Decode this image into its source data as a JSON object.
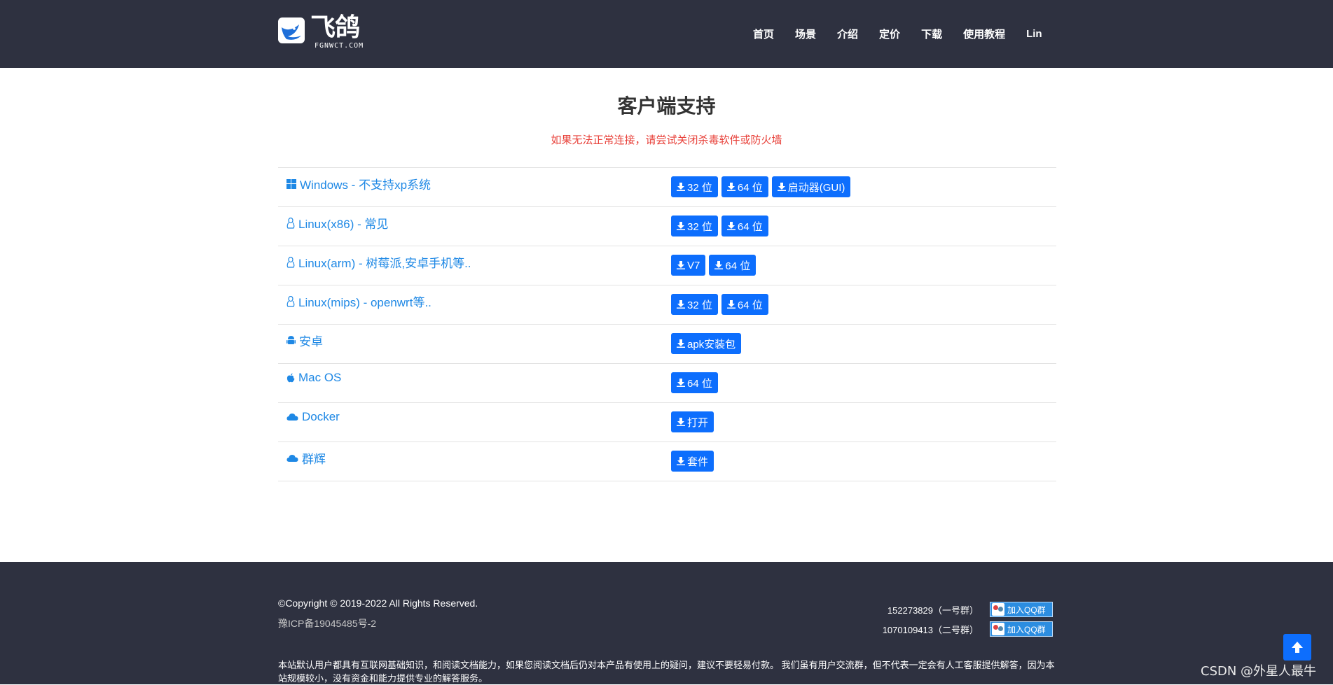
{
  "header": {
    "logo_text": "飞鸽",
    "logo_sub": "FGNWCT.COM",
    "nav": [
      "首页",
      "场景",
      "介绍",
      "定价",
      "下载",
      "使用教程",
      "Lin"
    ]
  },
  "main": {
    "title": "客户端支持",
    "subtitle": "如果无法正常连接，请尝试关闭杀毒软件或防火墙",
    "rows": [
      {
        "icon": "windows-icon",
        "label": "Windows - 不支持xp系统",
        "buttons": [
          "32 位",
          "64 位",
          "启动器(GUI)"
        ]
      },
      {
        "icon": "linux-icon",
        "label": "Linux(x86) - 常见",
        "buttons": [
          "32 位",
          "64 位"
        ]
      },
      {
        "icon": "linux-icon",
        "label": "Linux(arm) - 树莓派,安卓手机等..",
        "buttons": [
          "V7",
          "64 位"
        ]
      },
      {
        "icon": "linux-icon",
        "label": "Linux(mips) - openwrt等..",
        "buttons": [
          "32 位",
          "64 位"
        ]
      },
      {
        "icon": "android-icon",
        "label": "安卓",
        "buttons": [
          "apk安装包"
        ]
      },
      {
        "icon": "apple-icon",
        "label": "Mac OS",
        "buttons": [
          "64 位"
        ]
      },
      {
        "icon": "cloud-icon",
        "label": "Docker",
        "buttons": [
          "打开"
        ]
      },
      {
        "icon": "cloud-icon",
        "label": "群辉",
        "buttons": [
          "套件"
        ]
      }
    ]
  },
  "footer": {
    "copyright": "©Copyright © 2019-2022 All Rights Reserved.",
    "icp": "豫ICP备19045485号-2",
    "qq_groups": [
      {
        "number": "152273829（一号群）",
        "button": "加入QQ群"
      },
      {
        "number": "1070109413（二号群）",
        "button": "加入QQ群"
      }
    ],
    "disclaimer": "本站默认用户都具有互联网基础知识，和阅读文档能力，如果您阅读文档后仍对本产品有使用上的疑问，建议不要轻易付款。 我们虽有用户交流群，但不代表一定会有人工客服提供解答，因为本站规模较小，没有资金和能力提供专业的解答服务。"
  },
  "watermark": "CSDN @外星人最牛",
  "colors": {
    "header_bg": "#2e3140",
    "primary": "#0d6efd",
    "link": "#1e88e5",
    "warning_text": "#e8413a"
  }
}
